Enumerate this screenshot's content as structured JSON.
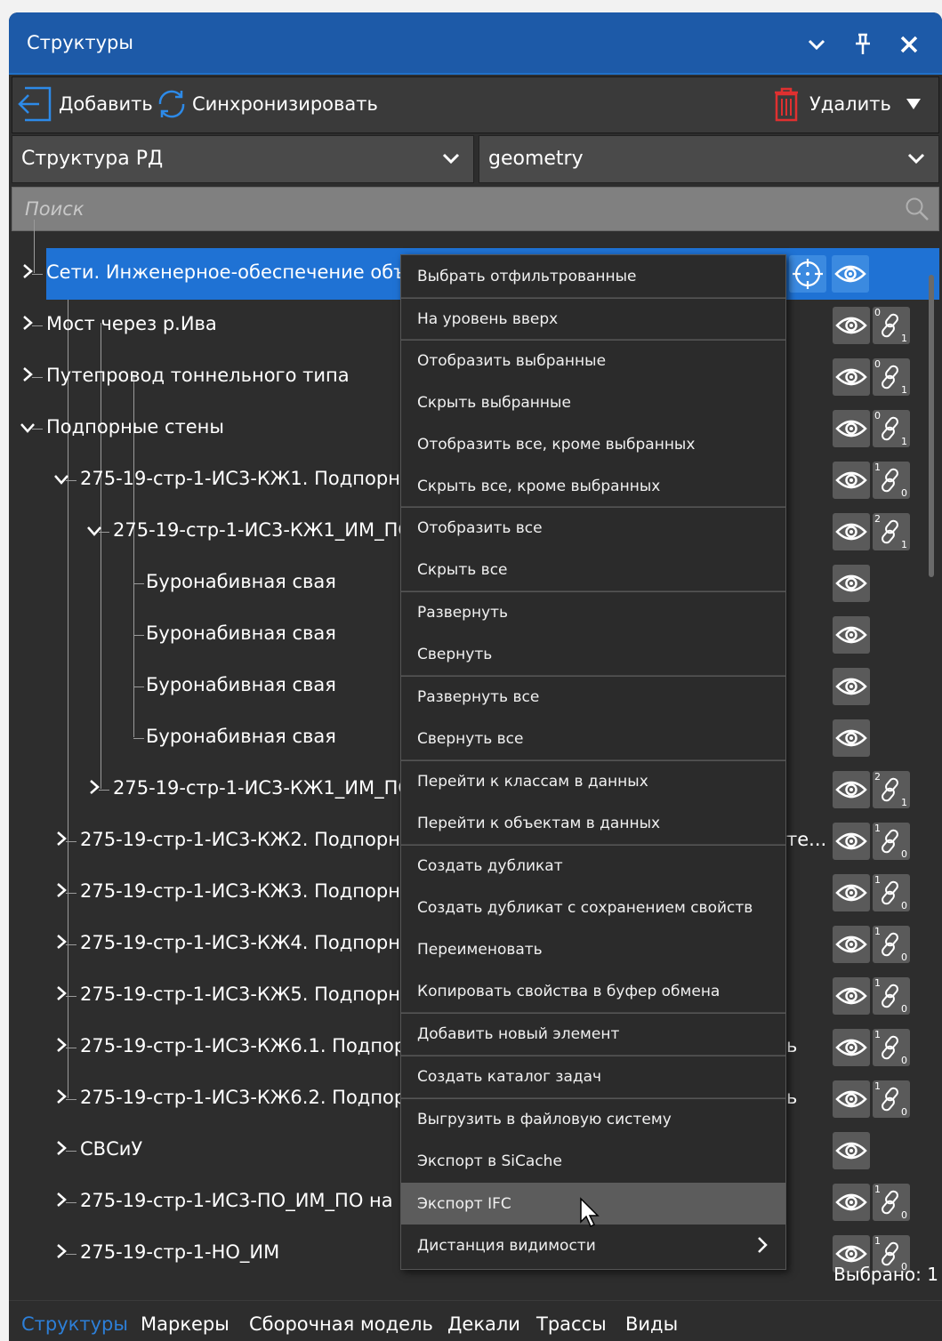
{
  "window": {
    "title": "Структуры"
  },
  "toolbar": {
    "add_label": "Добавить",
    "sync_label": "Синхронизировать",
    "delete_label": "Удалить"
  },
  "selectors": {
    "structure": "Структура РД",
    "geometry": "geometry"
  },
  "search": {
    "placeholder": "Поиск"
  },
  "tree": [
    {
      "label": "Сети. Инженерное-обеспечение объе",
      "selected": true
    },
    {
      "label": "Мост через р.Ива",
      "link": {
        "top": "0",
        "bottom": "1"
      }
    },
    {
      "label": "Путепровод тоннельного типа",
      "link": {
        "top": "0",
        "bottom": "1"
      }
    },
    {
      "label": "Подпорные стены",
      "link": {
        "top": "0",
        "bottom": "1"
      }
    },
    {
      "label": "275-19-стр-1-ИС3-КЖ1. Подпорны",
      "link": {
        "top": "1",
        "bottom": "0"
      }
    },
    {
      "label": "275-19-стр-1-ИС3-КЖ1_ИМ_ПС",
      "link": {
        "top": "2",
        "bottom": "1"
      }
    },
    {
      "label": "Буронабивная свая"
    },
    {
      "label": "Буронабивная свая"
    },
    {
      "label": "Буронабивная свая"
    },
    {
      "label": "Буронабивная свая"
    },
    {
      "label": "275-19-стр-1-ИС3-КЖ1_ИМ_ПС",
      "link": {
        "top": "2",
        "bottom": "1"
      }
    },
    {
      "label": "275-19-стр-1-ИС3-КЖ2. Подпорны",
      "suffix": "те...",
      "link": {
        "top": "1",
        "bottom": "0"
      }
    },
    {
      "label": "275-19-стр-1-ИС3-КЖ3. Подпорная",
      "link": {
        "top": "1",
        "bottom": "0"
      }
    },
    {
      "label": "275-19-стр-1-ИС3-КЖ4. Подпорная",
      "link": {
        "top": "1",
        "bottom": "0"
      }
    },
    {
      "label": "275-19-стр-1-ИС3-КЖ5. Подпорная",
      "link": {
        "top": "1",
        "bottom": "0"
      }
    },
    {
      "label": "275-19-стр-1-ИС3-КЖ6.1. Подпорн",
      "suffix": "ь",
      "link": {
        "top": "1",
        "bottom": "0"
      }
    },
    {
      "label": "275-19-стр-1-ИС3-КЖ6.2. Подпорн",
      "suffix": "ь",
      "link": {
        "top": "1",
        "bottom": "0"
      }
    },
    {
      "label": "СВСиУ"
    },
    {
      "label": "275-19-стр-1-ИС3-ПО_ИМ_ПО на п",
      "link": {
        "top": "1",
        "bottom": "0"
      }
    },
    {
      "label": "275-19-стр-1-НО_ИМ",
      "link": {
        "top": "1",
        "bottom": "0"
      }
    }
  ],
  "context_menu": [
    "Выбрать отфильтрованные",
    "На уровень вверх",
    "Отобразить выбранные",
    "Скрыть выбранные",
    "Отобразить все, кроме выбранных",
    "Скрыть все, кроме выбранных",
    "Отобразить все",
    "Скрыть все",
    "Развернуть",
    "Свернуть",
    "Развернуть все",
    "Свернуть все",
    "Перейти к классам в данных",
    "Перейти к объектам в данных",
    "Создать дубликат",
    "Создать дубликат с сохранением свойств",
    "Переименовать",
    "Копировать свойства в буфер обмена",
    "Добавить новый элемент",
    "Создать каталог задач",
    "Выгрузить в файловую систему",
    "Экспорт в SiCache",
    "Экспорт IFC",
    "Дистанция видимости"
  ],
  "context_menu_hovered": "Экспорт IFC",
  "status": {
    "selected": "Выбрано: 1"
  },
  "tabs": [
    "Структуры",
    "Маркеры",
    "Сборочная модель",
    "Декали",
    "Трассы",
    "Виды"
  ],
  "active_tab": "Структуры",
  "colors": {
    "title_bar": "#1d5aa8",
    "selection": "#1f72d4",
    "active_tab": "#2d7fd8",
    "panel_bg": "#2d2d2d",
    "delete_icon": "#e03030"
  },
  "icons": [
    "chevron-down-icon",
    "pin-icon",
    "close-icon",
    "add-icon",
    "sync-icon",
    "trash-icon",
    "search-icon",
    "eye-icon",
    "link-icon",
    "locate-icon",
    "cursor-icon"
  ]
}
